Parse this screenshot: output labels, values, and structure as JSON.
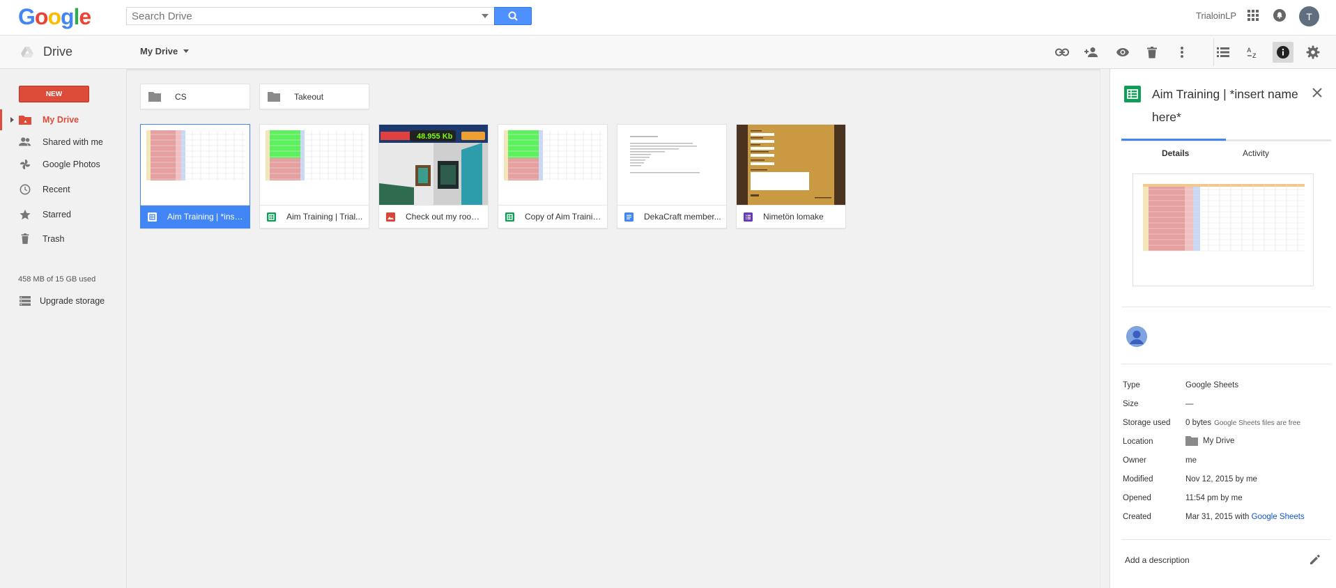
{
  "header": {
    "logo": [
      "G",
      "o",
      "o",
      "g",
      "l",
      "e"
    ],
    "logo_colors": [
      "#4285f4",
      "#ea4335",
      "#fbbc05",
      "#4285f4",
      "#34a853",
      "#ea4335"
    ],
    "search_placeholder": "Search Drive",
    "username": "TrialoinLP",
    "avatar_letter": "T"
  },
  "subbar": {
    "app_name": "Drive",
    "location": "My Drive",
    "toolbar": [
      "link-icon",
      "add-person-icon",
      "preview-eye-icon",
      "trash-icon",
      "more-vert-icon",
      "list-view-icon",
      "sort-az-icon",
      "info-icon",
      "settings-gear-icon"
    ]
  },
  "sidebar": {
    "new_label": "NEW",
    "items": [
      {
        "label": "My Drive",
        "icon": "my-drive-icon",
        "active": true
      },
      {
        "label": "Shared with me",
        "icon": "people-icon",
        "active": false
      },
      {
        "label": "Google Photos",
        "icon": "pinwheel-icon",
        "active": false
      },
      {
        "label": "Recent",
        "icon": "clock-icon",
        "active": false
      },
      {
        "label": "Starred",
        "icon": "star-icon",
        "active": false
      },
      {
        "label": "Trash",
        "icon": "trash-icon",
        "active": false
      }
    ],
    "storage": "458 MB of 15 GB used",
    "upgrade": "Upgrade storage"
  },
  "folders": [
    {
      "name": "CS"
    },
    {
      "name": "Takeout"
    }
  ],
  "files": [
    {
      "name": "Aim Training | *insert name here*",
      "short": "Aim Training | *inse...",
      "type": "sheets",
      "selected": true
    },
    {
      "name": "Aim Training | Trial...",
      "short": "Aim Training | Trial...",
      "type": "sheets",
      "selected": false
    },
    {
      "name": "Check out my room...",
      "short": "Check out my room...",
      "type": "image",
      "selected": false,
      "thumb_text": "48.955 Kb"
    },
    {
      "name": "Copy of Aim Trainin...",
      "short": "Copy of Aim Trainin...",
      "type": "sheets",
      "selected": false
    },
    {
      "name": "DekaCraft member...",
      "short": "DekaCraft member...",
      "type": "docs",
      "selected": false
    },
    {
      "name": "Nimetön lomake",
      "short": "Nimetön lomake",
      "type": "forms",
      "selected": false
    }
  ],
  "details": {
    "title": "Aim Training | *insert name here*",
    "tabs": [
      "Details",
      "Activity"
    ],
    "props": [
      {
        "key": "Type",
        "value": "Google Sheets"
      },
      {
        "key": "Size",
        "value": "—"
      },
      {
        "key": "Storage used",
        "value": "0 bytes",
        "note": "Google Sheets files are free"
      },
      {
        "key": "Location",
        "value": "My Drive"
      },
      {
        "key": "Owner",
        "value": "me"
      },
      {
        "key": "Modified",
        "value": "Nov 12, 2015 by me"
      },
      {
        "key": "Opened",
        "value": "11:54 pm by me"
      },
      {
        "key": "Created",
        "value": "Mar 31, 2015 with",
        "link": "Google Sheets"
      }
    ],
    "add_description": "Add a description"
  },
  "colors": {
    "accent_red": "#dd4b39",
    "accent_blue": "#4285f4",
    "sheets_green": "#0f9d58",
    "docs_blue": "#4285f4",
    "forms_purple": "#673ab7",
    "image_red": "#db4437"
  }
}
